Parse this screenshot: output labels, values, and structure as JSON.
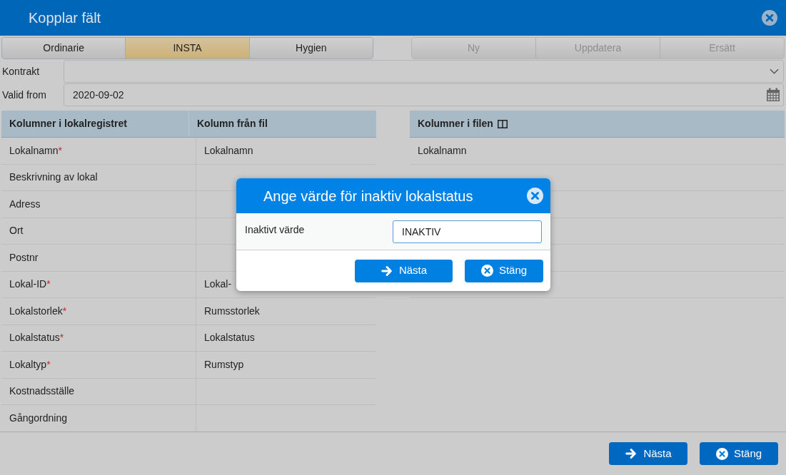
{
  "window": {
    "title": "Kopplar fält"
  },
  "tabs": [
    {
      "label": "Ordinarie",
      "selected": false
    },
    {
      "label": "INSTA",
      "selected": true
    },
    {
      "label": "Hygien",
      "selected": false
    }
  ],
  "actions": [
    {
      "label": "Ny",
      "disabled": true
    },
    {
      "label": "Uppdatera",
      "disabled": true
    },
    {
      "label": "Ersätt",
      "disabled": true
    }
  ],
  "fields": [
    {
      "kind": "select",
      "label": "Kontrakt"
    },
    {
      "kind": "date",
      "label": "Valid from",
      "value": "2020-09-02"
    }
  ],
  "mapping_table": {
    "columns": [
      "Kolumner i lokalregistret",
      "Kolumn från fil"
    ],
    "rows": [
      {
        "name": "Lokalnamn",
        "required_mark": "*",
        "mapped": "Lokalnamn"
      },
      {
        "name": "Beskrivning av lokal"
      },
      {
        "name": "Adress"
      },
      {
        "name": "Ort"
      },
      {
        "name": "Postnr"
      },
      {
        "name": "Lokal-ID",
        "required_mark": "*",
        "mapped": "Lokal-"
      },
      {
        "name": "Lokalstorlek",
        "required_mark": "*",
        "mapped": "Rumsstorlek"
      },
      {
        "name": "Lokalstatus",
        "required_mark": "*",
        "mapped": "Lokalstatus"
      },
      {
        "name": "Lokaltyp",
        "required_mark": "*",
        "mapped": "Rumstyp"
      },
      {
        "name": "Kostnadsställe"
      },
      {
        "name": "Gångordning"
      }
    ]
  },
  "file_table": {
    "column": "Kolumner i filen",
    "rows": [
      {
        "value": "Lokalnamn"
      },
      {},
      {},
      {},
      {},
      {}
    ]
  },
  "footer_buttons": [
    {
      "kind": "next",
      "label": "Nästa"
    },
    {
      "kind": "close",
      "label": "Stäng"
    }
  ],
  "dialog": {
    "title": "Ange värde för inaktiv lokalstatus",
    "field_label": "Inaktivt värde",
    "value": "INAKTIV",
    "buttons": [
      {
        "kind": "next",
        "label": "Nästa"
      },
      {
        "kind": "close",
        "label": "Stäng"
      }
    ]
  }
}
